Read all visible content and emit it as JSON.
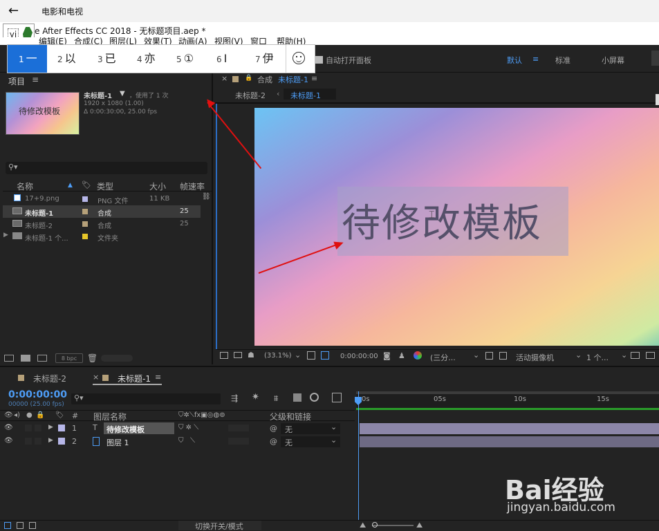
{
  "window": {
    "back_symbol": "←",
    "title": "电影和电视"
  },
  "ae_title": "e After Effects CC 2018 - 无标题项目.aep *",
  "ae_icon_letters": "yi",
  "menubar": [
    "编辑(E)",
    "合成(C)",
    "图层(L)",
    "效果(T)",
    "动画(A)",
    "视图(V)",
    "窗口",
    "帮助(H)"
  ],
  "ime": {
    "candidates": [
      {
        "n": "1",
        "t": "一"
      },
      {
        "n": "2",
        "t": "以"
      },
      {
        "n": "3",
        "t": "已"
      },
      {
        "n": "4",
        "t": "亦"
      },
      {
        "n": "5",
        "t": "①"
      },
      {
        "n": "6",
        "t": "I"
      },
      {
        "n": "7",
        "t": "伊"
      }
    ]
  },
  "toolbar": {
    "auto_open": "自动打开面板",
    "workspaces": [
      "默认",
      "≡",
      "标准",
      "小屏幕"
    ]
  },
  "project": {
    "header": "项目",
    "comp_name": "未标题-1",
    "used": "，使用了 1 次",
    "res": "1920 x 1080 (1.00)",
    "duration": "Δ 0:00:30:00, 25.00 fps",
    "thumb_text": "待修改模板",
    "columns": [
      "名称",
      "类型",
      "大小",
      "帧速率"
    ],
    "rows": [
      {
        "name": "17+9.png",
        "type": "PNG 文件",
        "size": "11 KB",
        "fps": "",
        "color": "#b6b6e8"
      },
      {
        "name": "未标题-1",
        "type": "合成",
        "size": "",
        "fps": "25",
        "color": "#b5a079"
      },
      {
        "name": "未标题-2",
        "type": "合成",
        "size": "",
        "fps": "25",
        "color": "#b5a079"
      },
      {
        "name": "未标题-1 个...",
        "type": "文件夹",
        "size": "",
        "fps": "",
        "color": "#e6c629"
      }
    ],
    "bpc": "8 bpc"
  },
  "comp": {
    "tab_prefix": "合成",
    "tab_name": "未标题-1",
    "breadcrumb": [
      "未标题-2",
      "未标题-1"
    ],
    "text": "待修改模板",
    "zoom": "(33.1%)",
    "timecode": "0:00:00:00",
    "view": "(三分...",
    "camera": "活动摄像机",
    "views": "1 个..."
  },
  "timeline": {
    "tabs": [
      "未标题-2",
      "未标题-1"
    ],
    "timecode": "0:00:00:00",
    "sub": "00000 (25.00 fps)",
    "col_layer_name": "图层名称",
    "col_parent": "父级和链接",
    "hash": "#",
    "layers": [
      {
        "num": "1",
        "type": "T",
        "name": "待修改模板",
        "parent": "无",
        "color": "#b6b6e8"
      },
      {
        "num": "2",
        "type": "img",
        "name": "图层 1",
        "parent": "无",
        "color": "#b6b6e8"
      }
    ],
    "ticks": [
      "0s",
      "05s",
      "10s",
      "15s"
    ],
    "toggle_label": "切换开关/模式"
  },
  "watermark": {
    "brand": "Bai经验",
    "url": "jingyan.baidu.com"
  },
  "colors": {
    "accent": "#4e9df6",
    "ime_selected": "#1b6fd8",
    "arrow": "#e01010"
  }
}
